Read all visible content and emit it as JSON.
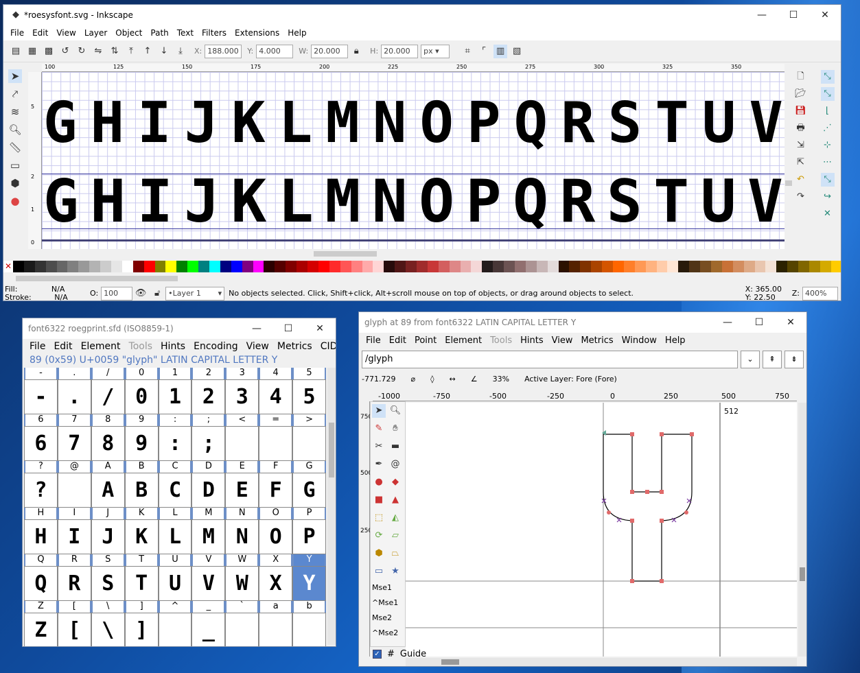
{
  "inkscape": {
    "title": "*roesysfont.svg - Inkscape",
    "menu": [
      "File",
      "Edit",
      "View",
      "Layer",
      "Object",
      "Path",
      "Text",
      "Filters",
      "Extensions",
      "Help"
    ],
    "toolbar": {
      "x_label": "X:",
      "x_value": "188.000",
      "y_label": "Y:",
      "y_value": "4.000",
      "w_label": "W:",
      "w_value": "20.000",
      "h_label": "H:",
      "h_value": "20.000",
      "unit": "px"
    },
    "ruler_h": [
      "100",
      "125",
      "150",
      "175",
      "200",
      "225",
      "250",
      "275",
      "300",
      "325",
      "350"
    ],
    "ruler_v": [
      "5",
      "2",
      "1",
      "0"
    ],
    "canvas": {
      "top_row": [
        "G",
        "H",
        "I",
        "J",
        "K",
        "L",
        "M",
        "N",
        "O",
        "P",
        "Q",
        "R",
        "S",
        "T",
        "U",
        "V"
      ],
      "bottom_row": [
        "G",
        "H",
        "I",
        "J",
        "K",
        "L",
        "M",
        "N",
        "O",
        "P",
        "Q",
        "R",
        "S",
        "T",
        "U",
        "V"
      ]
    },
    "status": {
      "fill_label": "Fill:",
      "fill_value": "N/A",
      "stroke_label": "Stroke:",
      "stroke_value": "N/A",
      "opacity_label": "O:",
      "opacity_value": "100",
      "layer": "•Layer 1",
      "message": "No objects selected. Click, Shift+click, Alt+scroll mouse on top of objects, or drag around objects to select.",
      "x_label": "X:",
      "x_value": "365.00",
      "y_label": "Y:",
      "y_value": "22.50",
      "z_label": "Z:",
      "zoom": "400%"
    },
    "palette": [
      "#000000",
      "#1a1a1a",
      "#333333",
      "#4d4d4d",
      "#666666",
      "#808080",
      "#999999",
      "#b3b3b3",
      "#cccccc",
      "#e6e6e6",
      "#ffffff",
      "#800000",
      "#ff0000",
      "#808000",
      "#ffff00",
      "#008000",
      "#00ff00",
      "#008080",
      "#00ffff",
      "#000080",
      "#0000ff",
      "#800080",
      "#ff00ff",
      "#2b0000",
      "#550000",
      "#800000",
      "#aa0000",
      "#d40000",
      "#ff0000",
      "#ff2a2a",
      "#ff5555",
      "#ff8080",
      "#ffaaaa",
      "#ffd5d5",
      "#280b0b",
      "#501616",
      "#782121",
      "#a02c2c",
      "#c83737",
      "#d35f5f",
      "#de8787",
      "#e9afaf",
      "#f4d7d7",
      "#241c1c",
      "#483737",
      "#6c5353",
      "#916f6f",
      "#ac9393",
      "#c8b7b7",
      "#e3dbdb",
      "#2b1100",
      "#552200",
      "#803300",
      "#aa4400",
      "#d45500",
      "#ff6600",
      "#ff7f2a",
      "#ff9955",
      "#ffb380",
      "#ffccaa",
      "#ffe6d5",
      "#281a0b",
      "#503416",
      "#784e21",
      "#a0692c",
      "#c87137",
      "#d38d5f",
      "#deaa87",
      "#e9c6af",
      "#f4e3d7",
      "#2b2200",
      "#554400",
      "#806600",
      "#aa8800",
      "#d4aa00",
      "#ffcc00"
    ]
  },
  "fontview": {
    "title": "font6322  roegprint.sfd (ISO8859-1)",
    "menu": [
      "File",
      "Edit",
      "Element",
      "Tools",
      "Hints",
      "Encoding",
      "View",
      "Metrics",
      "CID"
    ],
    "glyph_info": "89 (0x59) U+0059 \"glyph\" LATIN CAPITAL LETTER Y",
    "rows": [
      {
        "labels": [
          "-",
          ".",
          "/",
          "0",
          "1",
          "2",
          "3",
          "4",
          "5"
        ],
        "glyphs": [
          "-",
          ".",
          "/",
          "0",
          "1",
          "2",
          "3",
          "4",
          "5"
        ]
      },
      {
        "labels": [
          "6",
          "7",
          "8",
          "9",
          ":",
          ";",
          "<",
          "=",
          ">"
        ],
        "glyphs": [
          "6",
          "7",
          "8",
          "9",
          ":",
          ";",
          "",
          "",
          ""
        ]
      },
      {
        "labels": [
          "?",
          "@",
          "A",
          "B",
          "C",
          "D",
          "E",
          "F",
          "G"
        ],
        "glyphs": [
          "?",
          "",
          "A",
          "B",
          "C",
          "D",
          "E",
          "F",
          "G"
        ]
      },
      {
        "labels": [
          "H",
          "I",
          "J",
          "K",
          "L",
          "M",
          "N",
          "O",
          "P"
        ],
        "glyphs": [
          "H",
          "I",
          "J",
          "K",
          "L",
          "M",
          "N",
          "O",
          "P"
        ]
      },
      {
        "labels": [
          "Q",
          "R",
          "S",
          "T",
          "U",
          "V",
          "W",
          "X",
          "Y"
        ],
        "glyphs": [
          "Q",
          "R",
          "S",
          "T",
          "U",
          "V",
          "W",
          "X",
          "Y"
        ]
      },
      {
        "labels": [
          "Z",
          "[",
          "\\",
          "]",
          "^",
          "_",
          "`",
          "a",
          "b"
        ],
        "glyphs": [
          "Z",
          "[",
          "\\",
          "]",
          "",
          "_",
          "",
          "",
          ""
        ]
      }
    ]
  },
  "glyphwin": {
    "title": "glyph at 89 from font6322 LATIN CAPITAL LETTER Y",
    "menu": [
      "File",
      "Edit",
      "Point",
      "Element",
      "Tools",
      "Hints",
      "View",
      "Metrics",
      "Window",
      "Help"
    ],
    "search": "/glyph",
    "coord": "-771.729",
    "zoom": "33%",
    "active_layer": "Active Layer: Fore (Fore)",
    "ruler": [
      "-1000",
      "-750",
      "-500",
      "-250",
      "0",
      "250",
      "500",
      "750"
    ],
    "ruler_v": [
      "750",
      "500",
      "250"
    ],
    "advance": "512",
    "mouse_labels": [
      "Mse1",
      "^Mse1",
      "Mse2",
      "^Mse2"
    ],
    "layer_label": "#",
    "layer_name": "Guide"
  }
}
